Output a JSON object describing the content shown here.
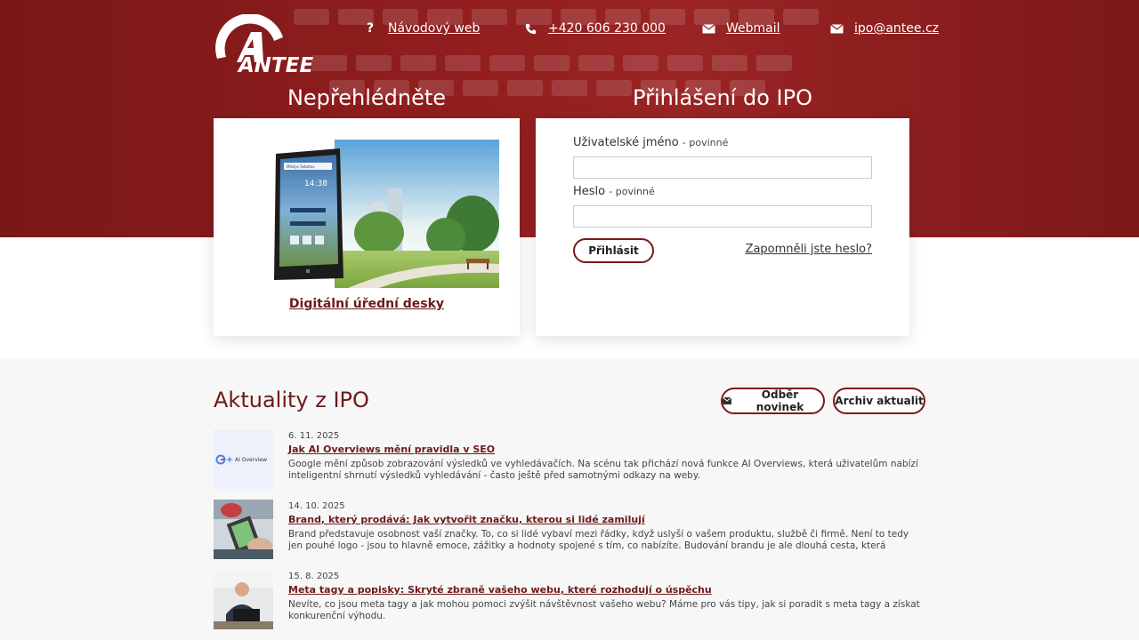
{
  "brand": {
    "logo_text": "ANTEE",
    "primary": "#8f1d1d",
    "accent": "#6d1a1a"
  },
  "topnav": [
    {
      "icon": "question-icon",
      "label": "Návodový web"
    },
    {
      "icon": "phone-icon",
      "label": "+420 606 230 000"
    },
    {
      "icon": "mail-icon",
      "label": "Webmail"
    },
    {
      "icon": "mail-icon",
      "label": "ipo@antee.cz"
    }
  ],
  "promo": {
    "title": "Nepřehlédněte",
    "link": "Digitální úřední desky",
    "tablet_header": "Městys Šebetov",
    "tablet_time": "14:38"
  },
  "login": {
    "title": "Přihlášení do IPO",
    "username_label": "Uživatelské jméno",
    "username_required": "- povinné",
    "username_value": "",
    "password_label": "Heslo",
    "password_required": "- povinné",
    "password_value": "",
    "submit": "Přihlásit",
    "forgot": "Zapomněli jste heslo?"
  },
  "news": {
    "title": "Aktuality z IPO",
    "subscribe": "Odběr novinek",
    "archive": "Archiv aktualit",
    "items": [
      {
        "date": "6. 11. 2025",
        "headline": "Jak AI Overviews mění pravidla v SEO",
        "excerpt": "Google mění způsob zobrazování výsledků ve vyhledávačích. Na scénu tak přichází nová funkce AI Overviews, která uživatelům nabízí inteligentní shrnutí výsledků vyhledávání - často ještě před samotnými odkazy na weby.",
        "thumb_label": "AI Overview"
      },
      {
        "date": "14. 10. 2025",
        "headline": "Brand, který prodává: Jak vytvořit značku, kterou si lidé zamilují",
        "excerpt": "Brand představuje osobnost vaší značky. To, co si lidé vybaví mezi řádky, když uslyší o vašem produktu, službě či firmě. Není to tedy jen pouhé logo - jsou to hlavně emoce, zážitky a hodnoty spojené s tím, co nabízíte. Budování brandu je ale dlouhá cesta, která vyžaduje čas, trpělivost a pravidelnou…"
      },
      {
        "date": "15. 8. 2025",
        "headline": "Meta tagy a popisky: Skryté zbraně vašeho webu, které rozhodují o úspěchu",
        "excerpt": "Nevíte, co jsou meta tagy a jak mohou pomoci zvýšit návštěvnost vašeho webu? Máme pro vás tipy, jak si poradit s meta tagy a získat konkurenční výhodu."
      }
    ]
  }
}
